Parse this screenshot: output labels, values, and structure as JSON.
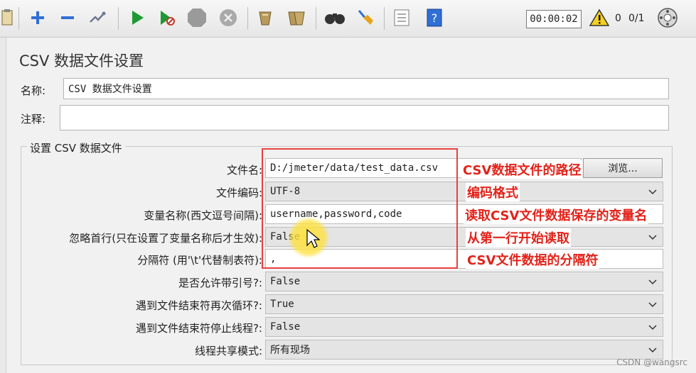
{
  "toolbar": {
    "timer": "00:00:02",
    "warning_count": "0",
    "threads": "0/1"
  },
  "title": "CSV 数据文件设置",
  "name_label": "名称:",
  "name_value": "CSV 数据文件设置",
  "comment_label": "注释:",
  "comment_value": "",
  "group_title": "设置 CSV 数据文件",
  "fields": {
    "filename": {
      "label": "文件名:",
      "value": "D:/jmeter/data/test_data.csv"
    },
    "encoding": {
      "label": "文件编码:",
      "value": "UTF-8"
    },
    "varnames": {
      "label": "变量名称(西文逗号间隔):",
      "value": "username,password,code"
    },
    "ignore_first": {
      "label": "忽略首行(只在设置了变量名称后才生效):",
      "value": "False"
    },
    "delimiter": {
      "label": "分隔符 (用'\\t'代替制表符):",
      "value": ","
    },
    "quoted": {
      "label": "是否允许带引号?:",
      "value": "False"
    },
    "recycle": {
      "label": "遇到文件结束符再次循环?:",
      "value": "True"
    },
    "stop_thread": {
      "label": "遇到文件结束符停止线程?:",
      "value": "False"
    },
    "sharing": {
      "label": "线程共享模式:",
      "value": "所有现场"
    }
  },
  "browse_label": "浏览...",
  "annotations": {
    "path": "CSV数据文件的路径",
    "encoding": "编码格式",
    "varnames": "读取CSV文件数据保存的变量名",
    "first_line": "从第一行开始读取",
    "delimiter": "CSV文件数据的分隔符"
  },
  "watermark": "CSDN @wangsrc",
  "colors": {
    "annotation": "#e2231a",
    "panel": "#f1f1f1"
  }
}
